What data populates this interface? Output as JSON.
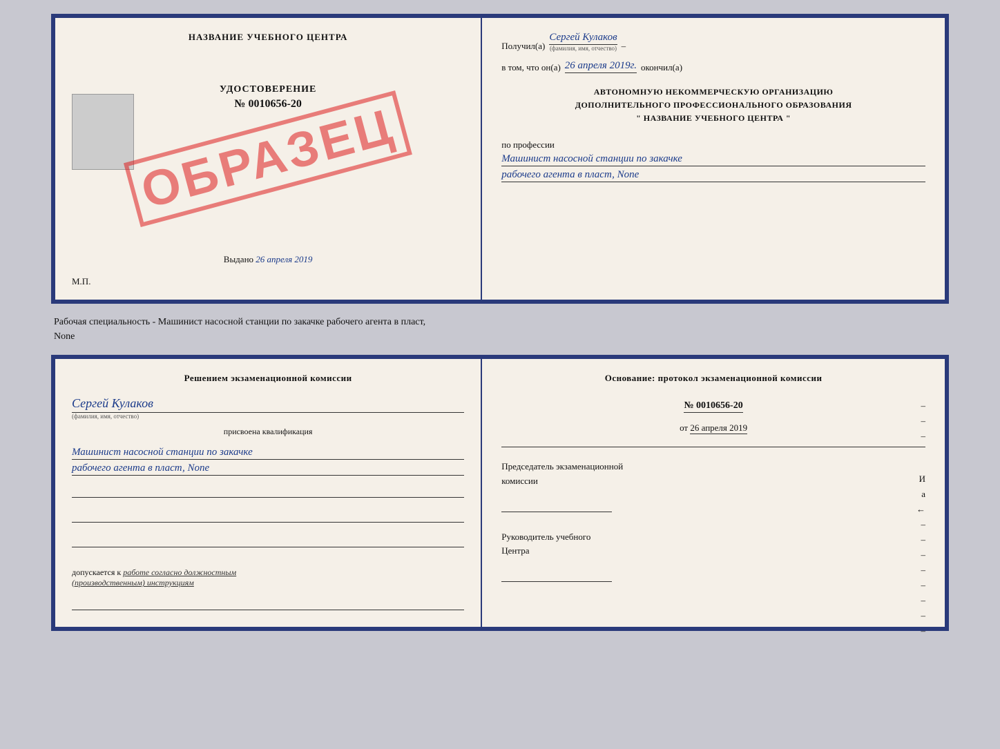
{
  "topDoc": {
    "leftTitle": "НАЗВАНИЕ УЧЕБНОГО ЦЕНТРА",
    "photoAlt": "photo",
    "uddTitle": "УДОСТОВЕРЕНИЕ",
    "uddNum": "№ 0010656-20",
    "vydano": "Выдано",
    "vydanoDate": "26 апреля 2019",
    "mpLabel": "М.П.",
    "obrazec": "ОБРАЗЕЦ"
  },
  "topRight": {
    "poluchilLabel": "Получил(а)",
    "poluchilName": "Сергей Кулаков",
    "familiyaHint": "(фамилия, имя, отчество)",
    "vtomLabel": "в том, что он(а)",
    "vtomDate": "26 апреля 2019г.",
    "okonchilLabel": "окончил(а)",
    "orgLine1": "АВТОНОМНУЮ НЕКОММЕРЧЕСКУЮ ОРГАНИЗАЦИЮ",
    "orgLine2": "ДОПОЛНИТЕЛЬНОГО ПРОФЕССИОНАЛЬНОГО ОБРАЗОВАНИЯ",
    "orgLine3": "\"    НАЗВАНИЕ УЧЕБНОГО ЦЕНТРА    \"",
    "poProfessii": "по профессии",
    "profLine1": "Машинист насосной станции по закачке",
    "profLine2": "рабочего агента в пласт, None"
  },
  "subtitle": "Рабочая специальность - Машинист насосной станции по закачке рабочего агента в пласт,\nNone",
  "bottomLeft": {
    "resheniemTitle": "Решением экзаменационной комиссии",
    "nameHandwritten": "Сергей Кулаков",
    "nameHint": "(фамилия, имя, отчество)",
    "prisvoenaLabel": "присвоена квалификация",
    "qualLine1": "Машинист насосной станции по закачке",
    "qualLine2": "рабочего агента в пласт, None",
    "dopuskaetsyaLabel": "допускается к",
    "dopuskaetsyaText": "работе согласно должностным (производственным) инструкциям"
  },
  "bottomRight": {
    "osnovanieLabel": "Основание: протокол экзаменационной комиссии",
    "protocolNum": "№ 0010656-20",
    "otLabel": "от",
    "otDate": "26 апреля 2019",
    "predsedatelLabel": "Председатель экзаменационной\nкомиссии",
    "rukovoditelLabel": "Руководитель учебного\nЦентра"
  }
}
